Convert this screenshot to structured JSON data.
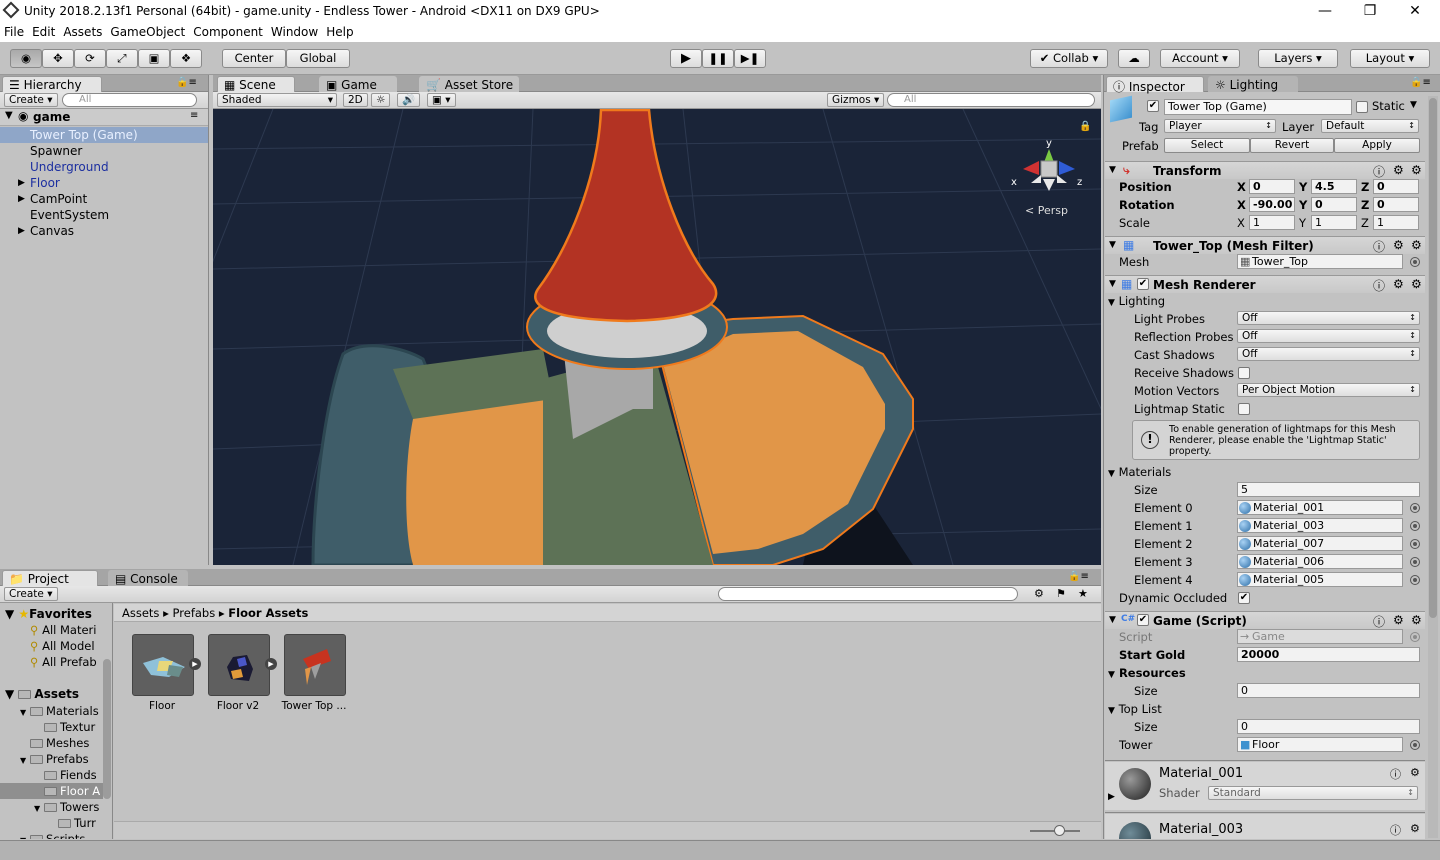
{
  "window": {
    "title": "Unity 2018.2.13f1 Personal (64bit) - game.unity - Endless Tower - Android <DX11 on DX9 GPU>"
  },
  "menu": [
    "File",
    "Edit",
    "Assets",
    "GameObject",
    "Component",
    "Window",
    "Help"
  ],
  "toolbar": {
    "pivot": "Center",
    "space": "Global",
    "collab": "Collab",
    "account": "Account",
    "layers": "Layers",
    "layout": "Layout"
  },
  "hierarchy": {
    "tab": "Hierarchy",
    "create": "Create",
    "search_placeholder": "All",
    "scene": "game",
    "items": [
      {
        "label": "Tower Top (Game)",
        "selected": true,
        "prefab": true,
        "fold": false
      },
      {
        "label": "Spawner",
        "prefab": false,
        "fold": false
      },
      {
        "label": "Underground",
        "prefab": true,
        "fold": false
      },
      {
        "label": "Floor",
        "prefab": true,
        "fold": true
      },
      {
        "label": "CamPoint",
        "prefab": false,
        "fold": true
      },
      {
        "label": "EventSystem",
        "prefab": false,
        "fold": false
      },
      {
        "label": "Canvas",
        "prefab": false,
        "fold": true
      }
    ]
  },
  "scene": {
    "tabs": [
      "Scene",
      "Game",
      "Asset Store"
    ],
    "shading": "Shaded",
    "mode2d": "2D",
    "gizmos": "Gizmos",
    "search_placeholder": "All",
    "persp": "Persp",
    "axes": {
      "x": "x",
      "y": "y",
      "z": "z"
    }
  },
  "project": {
    "tabs": [
      "Project",
      "Console"
    ],
    "create": "Create",
    "breadcrumb": [
      "Assets",
      "Prefabs",
      "Floor Assets"
    ],
    "favorites_label": "Favorites",
    "favorites": [
      "All Materi",
      "All Model",
      "All Prefab"
    ],
    "assets_label": "Assets",
    "tree": [
      {
        "label": "Materials",
        "depth": 1,
        "fold": "open"
      },
      {
        "label": "Textur",
        "depth": 2,
        "fold": ""
      },
      {
        "label": "Meshes",
        "depth": 1,
        "fold": ""
      },
      {
        "label": "Prefabs",
        "depth": 1,
        "fold": "open"
      },
      {
        "label": "Fiends",
        "depth": 2,
        "fold": ""
      },
      {
        "label": "Floor A",
        "depth": 2,
        "fold": "",
        "selected": true
      },
      {
        "label": "Towers",
        "depth": 2,
        "fold": "open"
      },
      {
        "label": "Turr",
        "depth": 3,
        "fold": ""
      },
      {
        "label": "Scripts",
        "depth": 1,
        "fold": "open"
      }
    ],
    "items": [
      "Floor",
      "Floor v2",
      "Tower Top ..."
    ]
  },
  "inspector": {
    "tabs": [
      "Inspector",
      "Lighting"
    ],
    "name": "Tower Top (Game)",
    "static_label": "Static",
    "tag_label": "Tag",
    "tag": "Player",
    "layer_label": "Layer",
    "layer": "Default",
    "prefab_label": "Prefab",
    "prefab_select": "Select",
    "prefab_revert": "Revert",
    "prefab_apply": "Apply",
    "transform": {
      "title": "Transform",
      "position_label": "Position",
      "rotation_label": "Rotation",
      "scale_label": "Scale",
      "x": "X",
      "y": "Y",
      "z": "Z",
      "position": [
        "0",
        "4.5",
        "0"
      ],
      "rotation": [
        "-90.00",
        "0",
        "0"
      ],
      "scale": [
        "1",
        "1",
        "1"
      ]
    },
    "mesh_filter": {
      "title": "Tower_Top (Mesh Filter)",
      "mesh_label": "Mesh",
      "mesh": "Tower_Top"
    },
    "mesh_renderer": {
      "title": "Mesh Renderer",
      "lighting_label": "Lighting",
      "light_probes_label": "Light Probes",
      "light_probes": "Off",
      "reflection_probes_label": "Reflection Probes",
      "reflection_probes": "Off",
      "cast_shadows_label": "Cast Shadows",
      "cast_shadows": "Off",
      "receive_shadows_label": "Receive Shadows",
      "motion_vectors_label": "Motion Vectors",
      "motion_vectors": "Per Object Motion",
      "lightmap_static_label": "Lightmap Static",
      "info": "To enable generation of lightmaps for this Mesh Renderer, please enable the 'Lightmap Static' property.",
      "materials_label": "Materials",
      "size_label": "Size",
      "size": "5",
      "elements": [
        {
          "label": "Element 0",
          "value": "Material_001"
        },
        {
          "label": "Element 1",
          "value": "Material_003"
        },
        {
          "label": "Element 2",
          "value": "Material_007"
        },
        {
          "label": "Element 3",
          "value": "Material_006"
        },
        {
          "label": "Element 4",
          "value": "Material_005"
        }
      ],
      "dynamic_occluded_label": "Dynamic Occluded"
    },
    "game_script": {
      "title": "Game (Script)",
      "script_label": "Script",
      "script": "Game",
      "start_gold_label": "Start Gold",
      "start_gold": "20000",
      "resources_label": "Resources",
      "resources_size_label": "Size",
      "resources_size": "0",
      "top_list_label": "Top List",
      "top_list_size_label": "Size",
      "top_list_size": "0",
      "tower_label": "Tower",
      "tower": "Floor"
    },
    "materials": [
      {
        "name": "Material_001",
        "shader_label": "Shader",
        "shader": "Standard"
      },
      {
        "name": "Material_003"
      }
    ]
  },
  "colors": {
    "sky": "#1a2438",
    "selection": "#3e7ce5",
    "outline": "#f07a1c"
  }
}
